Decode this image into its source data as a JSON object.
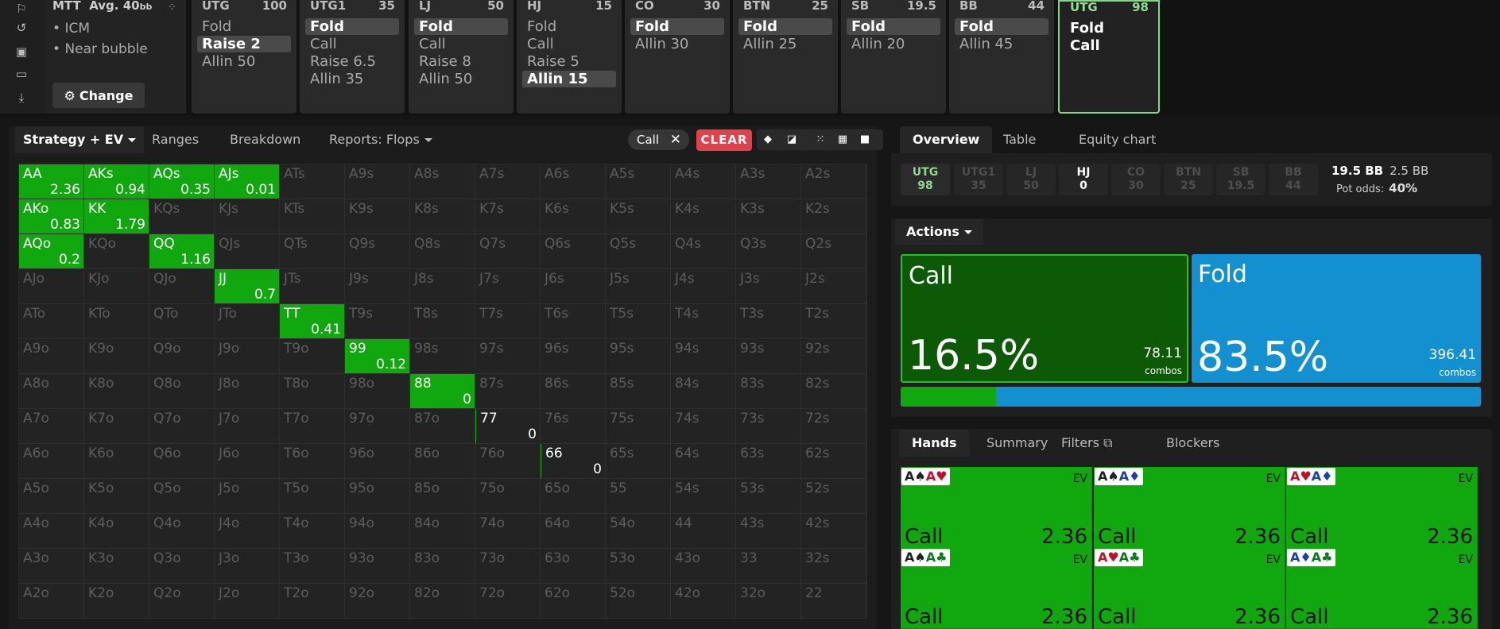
{
  "left_rail": {
    "icons": [
      "bookmark-icon",
      "history-icon",
      "save-icon",
      "gamepad-icon",
      "align-icon"
    ]
  },
  "tournament": {
    "title": "MTT",
    "avg_label": "Avg. 40",
    "avg_unit": "bb",
    "bullets": [
      "ICM",
      "Near bubble"
    ],
    "change_label": "Change"
  },
  "positions": [
    {
      "pos": "UTG",
      "stack": "100",
      "actions": [
        {
          "label": "Fold",
          "selected": false
        },
        {
          "label": "Raise 2",
          "selected": true
        },
        {
          "label": "Allin 50",
          "selected": false
        }
      ]
    },
    {
      "pos": "UTG1",
      "stack": "35",
      "actions": [
        {
          "label": "Fold",
          "selected": true
        },
        {
          "label": "Call",
          "selected": false
        },
        {
          "label": "Raise 6.5",
          "selected": false
        },
        {
          "label": "Allin 35",
          "selected": false
        }
      ]
    },
    {
      "pos": "LJ",
      "stack": "50",
      "actions": [
        {
          "label": "Fold",
          "selected": true
        },
        {
          "label": "Call",
          "selected": false
        },
        {
          "label": "Raise 8",
          "selected": false
        },
        {
          "label": "Allin 50",
          "selected": false
        }
      ]
    },
    {
      "pos": "HJ",
      "stack": "15",
      "actions": [
        {
          "label": "Fold",
          "selected": false
        },
        {
          "label": "Call",
          "selected": false
        },
        {
          "label": "Raise 5",
          "selected": false
        },
        {
          "label": "Allin 15",
          "selected": true
        }
      ]
    },
    {
      "pos": "CO",
      "stack": "30",
      "actions": [
        {
          "label": "Fold",
          "selected": true
        },
        {
          "label": "Allin 30",
          "selected": false
        }
      ]
    },
    {
      "pos": "BTN",
      "stack": "25",
      "actions": [
        {
          "label": "Fold",
          "selected": true
        },
        {
          "label": "Allin 25",
          "selected": false
        }
      ]
    },
    {
      "pos": "SB",
      "stack": "19.5",
      "actions": [
        {
          "label": "Fold",
          "selected": true
        },
        {
          "label": "Allin 20",
          "selected": false
        }
      ]
    },
    {
      "pos": "BB",
      "stack": "44",
      "actions": [
        {
          "label": "Fold",
          "selected": true
        },
        {
          "label": "Allin 45",
          "selected": false
        }
      ]
    },
    {
      "pos": "UTG",
      "stack": "98",
      "active": true,
      "actions": [
        {
          "label": "Fold",
          "selected": false
        },
        {
          "label": "Call",
          "selected": false
        }
      ]
    }
  ],
  "left_tabs": {
    "strategy": "Strategy + EV",
    "ranges": "Ranges",
    "breakdown": "Breakdown",
    "reports": "Reports: Flops"
  },
  "filter_chip": "Call",
  "clear_label": "CLEAR",
  "matrix": [
    [
      [
        "AA",
        "2.36"
      ],
      [
        "AKs",
        "0.94"
      ],
      [
        "AQs",
        "0.35"
      ],
      [
        "AJs",
        "0.01"
      ],
      [
        "ATs",
        ""
      ],
      [
        "A9s",
        ""
      ],
      [
        "A8s",
        ""
      ],
      [
        "A7s",
        ""
      ],
      [
        "A6s",
        ""
      ],
      [
        "A5s",
        ""
      ],
      [
        "A4s",
        ""
      ],
      [
        "A3s",
        ""
      ],
      [
        "A2s",
        ""
      ]
    ],
    [
      [
        "AKo",
        "0.83"
      ],
      [
        "KK",
        "1.79"
      ],
      [
        "KQs",
        ""
      ],
      [
        "KJs",
        ""
      ],
      [
        "KTs",
        ""
      ],
      [
        "K9s",
        ""
      ],
      [
        "K8s",
        ""
      ],
      [
        "K7s",
        ""
      ],
      [
        "K6s",
        ""
      ],
      [
        "K5s",
        ""
      ],
      [
        "K4s",
        ""
      ],
      [
        "K3s",
        ""
      ],
      [
        "K2s",
        ""
      ]
    ],
    [
      [
        "AQo",
        "0.2"
      ],
      [
        "KQo",
        ""
      ],
      [
        "QQ",
        "1.16"
      ],
      [
        "QJs",
        ""
      ],
      [
        "QTs",
        ""
      ],
      [
        "Q9s",
        ""
      ],
      [
        "Q8s",
        ""
      ],
      [
        "Q7s",
        ""
      ],
      [
        "Q6s",
        ""
      ],
      [
        "Q5s",
        ""
      ],
      [
        "Q4s",
        ""
      ],
      [
        "Q3s",
        ""
      ],
      [
        "Q2s",
        ""
      ]
    ],
    [
      [
        "AJo",
        ""
      ],
      [
        "KJo",
        ""
      ],
      [
        "QJo",
        ""
      ],
      [
        "JJ",
        "0.7"
      ],
      [
        "JTs",
        ""
      ],
      [
        "J9s",
        ""
      ],
      [
        "J8s",
        ""
      ],
      [
        "J7s",
        ""
      ],
      [
        "J6s",
        ""
      ],
      [
        "J5s",
        ""
      ],
      [
        "J4s",
        ""
      ],
      [
        "J3s",
        ""
      ],
      [
        "J2s",
        ""
      ]
    ],
    [
      [
        "ATo",
        ""
      ],
      [
        "KTo",
        ""
      ],
      [
        "QTo",
        ""
      ],
      [
        "JTo",
        ""
      ],
      [
        "TT",
        "0.41"
      ],
      [
        "T9s",
        ""
      ],
      [
        "T8s",
        ""
      ],
      [
        "T7s",
        ""
      ],
      [
        "T6s",
        ""
      ],
      [
        "T5s",
        ""
      ],
      [
        "T4s",
        ""
      ],
      [
        "T3s",
        ""
      ],
      [
        "T2s",
        ""
      ]
    ],
    [
      [
        "A9o",
        ""
      ],
      [
        "K9o",
        ""
      ],
      [
        "Q9o",
        ""
      ],
      [
        "J9o",
        ""
      ],
      [
        "T9o",
        ""
      ],
      [
        "99",
        "0.12"
      ],
      [
        "98s",
        ""
      ],
      [
        "97s",
        ""
      ],
      [
        "96s",
        ""
      ],
      [
        "95s",
        ""
      ],
      [
        "94s",
        ""
      ],
      [
        "93s",
        ""
      ],
      [
        "92s",
        ""
      ]
    ],
    [
      [
        "A8o",
        ""
      ],
      [
        "K8o",
        ""
      ],
      [
        "Q8o",
        ""
      ],
      [
        "J8o",
        ""
      ],
      [
        "T8o",
        ""
      ],
      [
        "98o",
        ""
      ],
      [
        "88",
        "0"
      ],
      [
        "87s",
        ""
      ],
      [
        "86s",
        ""
      ],
      [
        "85s",
        ""
      ],
      [
        "84s",
        ""
      ],
      [
        "83s",
        ""
      ],
      [
        "82s",
        ""
      ]
    ],
    [
      [
        "A7o",
        ""
      ],
      [
        "K7o",
        ""
      ],
      [
        "Q7o",
        ""
      ],
      [
        "J7o",
        ""
      ],
      [
        "T7o",
        ""
      ],
      [
        "97o",
        ""
      ],
      [
        "87o",
        ""
      ],
      [
        "77",
        "0"
      ],
      [
        "76s",
        ""
      ],
      [
        "75s",
        ""
      ],
      [
        "74s",
        ""
      ],
      [
        "73s",
        ""
      ],
      [
        "72s",
        ""
      ]
    ],
    [
      [
        "A6o",
        ""
      ],
      [
        "K6o",
        ""
      ],
      [
        "Q6o",
        ""
      ],
      [
        "J6o",
        ""
      ],
      [
        "T6o",
        ""
      ],
      [
        "96o",
        ""
      ],
      [
        "86o",
        ""
      ],
      [
        "76o",
        ""
      ],
      [
        "66",
        "0"
      ],
      [
        "65s",
        ""
      ],
      [
        "64s",
        ""
      ],
      [
        "63s",
        ""
      ],
      [
        "62s",
        ""
      ]
    ],
    [
      [
        "A5o",
        ""
      ],
      [
        "K5o",
        ""
      ],
      [
        "Q5o",
        ""
      ],
      [
        "J5o",
        ""
      ],
      [
        "T5o",
        ""
      ],
      [
        "95o",
        ""
      ],
      [
        "85o",
        ""
      ],
      [
        "75o",
        ""
      ],
      [
        "65o",
        ""
      ],
      [
        "55",
        ""
      ],
      [
        "54s",
        ""
      ],
      [
        "53s",
        ""
      ],
      [
        "52s",
        ""
      ]
    ],
    [
      [
        "A4o",
        ""
      ],
      [
        "K4o",
        ""
      ],
      [
        "Q4o",
        ""
      ],
      [
        "J4o",
        ""
      ],
      [
        "T4o",
        ""
      ],
      [
        "94o",
        ""
      ],
      [
        "84o",
        ""
      ],
      [
        "74o",
        ""
      ],
      [
        "64o",
        ""
      ],
      [
        "54o",
        ""
      ],
      [
        "44",
        ""
      ],
      [
        "43s",
        ""
      ],
      [
        "42s",
        ""
      ]
    ],
    [
      [
        "A3o",
        ""
      ],
      [
        "K3o",
        ""
      ],
      [
        "Q3o",
        ""
      ],
      [
        "J3o",
        ""
      ],
      [
        "T3o",
        ""
      ],
      [
        "93o",
        ""
      ],
      [
        "83o",
        ""
      ],
      [
        "73o",
        ""
      ],
      [
        "63o",
        ""
      ],
      [
        "53o",
        ""
      ],
      [
        "43o",
        ""
      ],
      [
        "33",
        ""
      ],
      [
        "32s",
        ""
      ]
    ],
    [
      [
        "A2o",
        ""
      ],
      [
        "K2o",
        ""
      ],
      [
        "Q2o",
        ""
      ],
      [
        "J2o",
        ""
      ],
      [
        "T2o",
        ""
      ],
      [
        "92o",
        ""
      ],
      [
        "82o",
        ""
      ],
      [
        "72o",
        ""
      ],
      [
        "62o",
        ""
      ],
      [
        "52o",
        ""
      ],
      [
        "42o",
        ""
      ],
      [
        "32o",
        ""
      ],
      [
        "22",
        ""
      ]
    ]
  ],
  "matrix_green": [
    "AA",
    "AKs",
    "AQs",
    "AJs",
    "AKo",
    "KK",
    "AQo",
    "QQ",
    "JJ",
    "TT",
    "99",
    "88"
  ],
  "matrix_thin": [
    "77",
    "66"
  ],
  "right_tabs": {
    "overview": "Overview",
    "table": "Table",
    "equity": "Equity chart"
  },
  "pos_summary": [
    {
      "pos": "UTG",
      "val": "98",
      "state": "utg"
    },
    {
      "pos": "UTG1",
      "val": "35",
      "state": "dim"
    },
    {
      "pos": "LJ",
      "val": "50",
      "state": "dim"
    },
    {
      "pos": "HJ",
      "val": "0",
      "state": "hj"
    },
    {
      "pos": "CO",
      "val": "30",
      "state": "dim"
    },
    {
      "pos": "BTN",
      "val": "25",
      "state": "dim"
    },
    {
      "pos": "SB",
      "val": "19.5",
      "state": "dim"
    },
    {
      "pos": "BB",
      "val": "44",
      "state": "dim"
    }
  ],
  "pot": {
    "bb": "19.5 BB",
    "bb2": "2.5 BB",
    "odds_label": "Pot odds:",
    "odds_value": "40%"
  },
  "actions_label": "Actions",
  "call": {
    "label": "Call",
    "pct": "16.5%",
    "combos": "78.11",
    "combos_label": "combos",
    "share": 0.165
  },
  "fold": {
    "label": "Fold",
    "pct": "83.5%",
    "combos": "396.41",
    "combos_label": "combos"
  },
  "hands_tabs": {
    "hands": "Hands",
    "summary": "Summary",
    "filters": "Filters",
    "blockers": "Blockers"
  },
  "hands": [
    {
      "combo": [
        [
          "A",
          "♠",
          "b"
        ],
        [
          "A",
          "♥",
          "r"
        ]
      ],
      "ev": "EV",
      "action": "Call",
      "value": "2.36"
    },
    {
      "combo": [
        [
          "A",
          "♠",
          "b"
        ],
        [
          "A",
          "♦",
          "bl"
        ]
      ],
      "ev": "EV",
      "action": "Call",
      "value": "2.36"
    },
    {
      "combo": [
        [
          "A",
          "♥",
          "r"
        ],
        [
          "A",
          "♦",
          "bl"
        ]
      ],
      "ev": "EV",
      "action": "Call",
      "value": "2.36"
    },
    {
      "combo": [
        [
          "A",
          "♠",
          "b"
        ],
        [
          "A",
          "♣",
          "g"
        ]
      ],
      "ev": "EV",
      "action": "Call",
      "value": "2.36"
    },
    {
      "combo": [
        [
          "A",
          "♥",
          "r"
        ],
        [
          "A",
          "♣",
          "g"
        ]
      ],
      "ev": "EV",
      "action": "Call",
      "value": "2.36"
    },
    {
      "combo": [
        [
          "A",
          "♦",
          "bl"
        ],
        [
          "A",
          "♣",
          "g"
        ]
      ],
      "ev": "EV",
      "action": "Call",
      "value": "2.36"
    }
  ]
}
